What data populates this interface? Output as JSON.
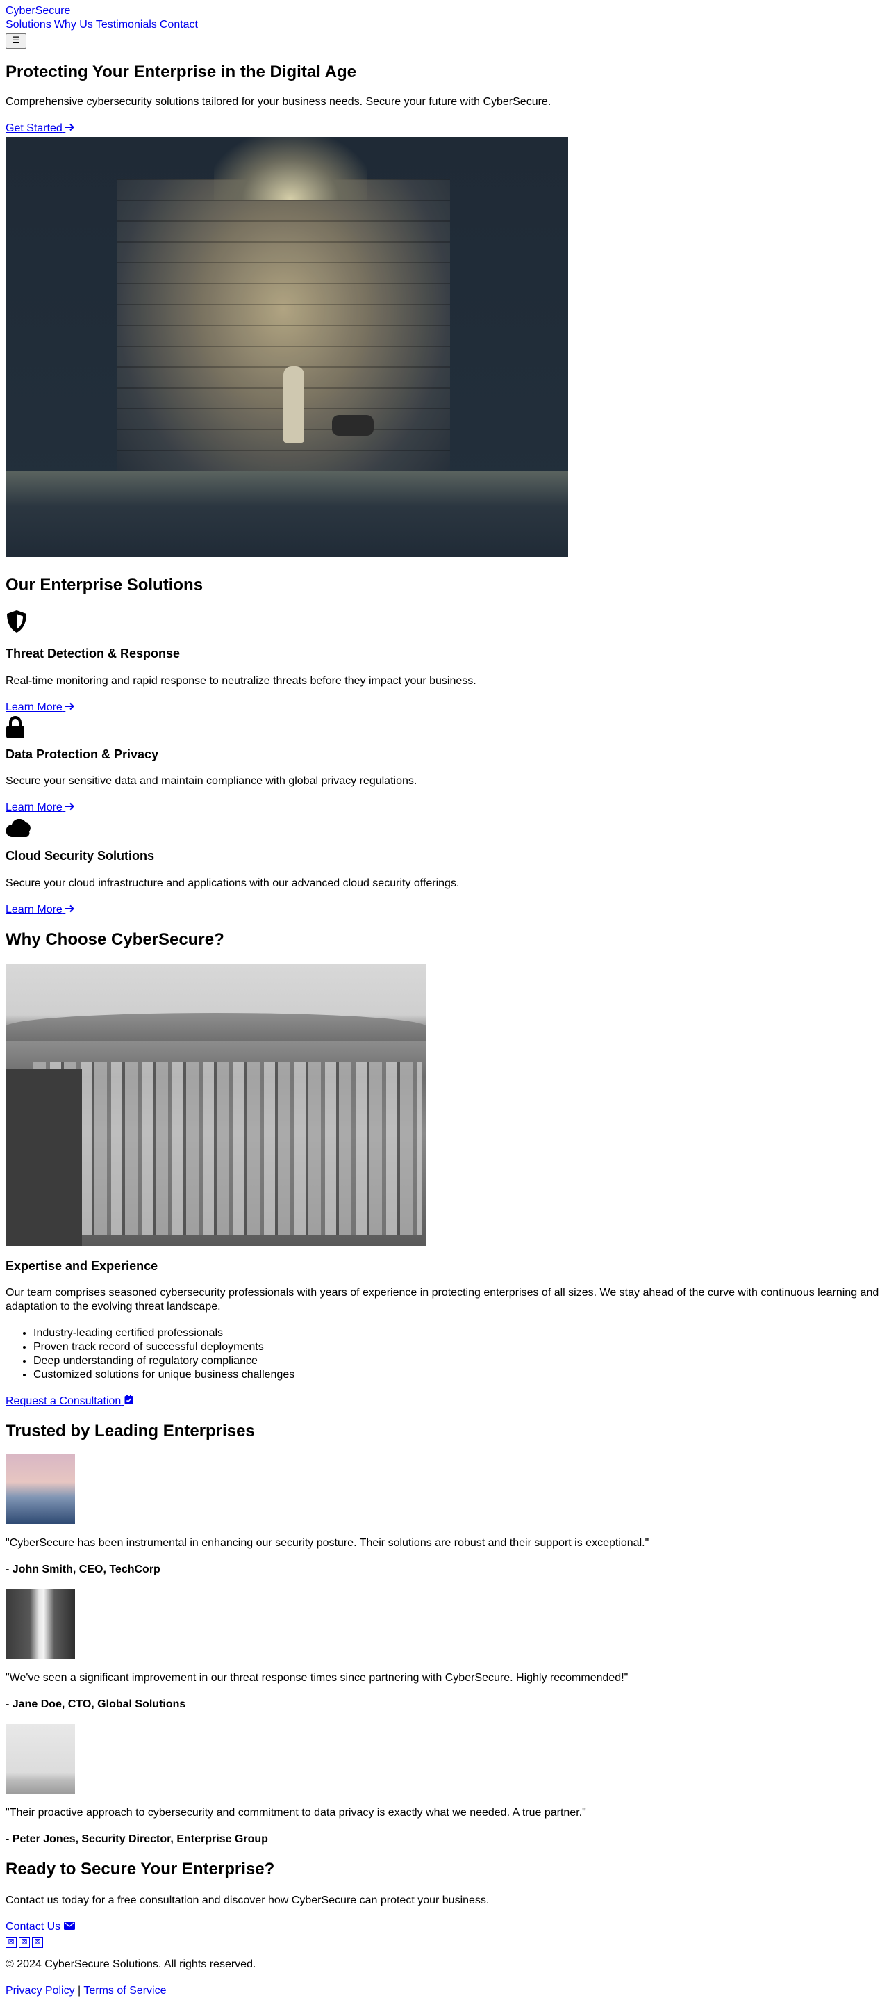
{
  "nav": {
    "brand": "CyberSecure",
    "links": [
      "Solutions",
      "Why Us",
      "Testimonials",
      "Contact"
    ],
    "menu_icon": "☰"
  },
  "hero": {
    "title": "Protecting Your Enterprise in the Digital Age",
    "subtitle": "Comprehensive cybersecurity solutions tailored for your business needs. Secure your future with CyberSecure.",
    "cta_label": "Get Started",
    "cta_icon": "arrow-right-icon"
  },
  "solutions": {
    "heading": "Our Enterprise Solutions",
    "items": [
      {
        "icon": "shield-icon",
        "title": "Threat Detection & Response",
        "description": "Real-time monitoring and rapid response to neutralize threats before they impact your business.",
        "link_label": "Learn More"
      },
      {
        "icon": "lock-icon",
        "title": "Data Protection & Privacy",
        "description": "Secure your sensitive data and maintain compliance with global privacy regulations.",
        "link_label": "Learn More"
      },
      {
        "icon": "cloud-icon",
        "title": "Cloud Security Solutions",
        "description": "Secure your cloud infrastructure and applications with our advanced cloud security offerings.",
        "link_label": "Learn More"
      }
    ]
  },
  "why": {
    "heading": "Why Choose CyberSecure?",
    "subheading": "Expertise and Experience",
    "body": "Our team comprises seasoned cybersecurity professionals with years of experience in protecting enterprises of all sizes. We stay ahead of the curve with continuous learning and adaptation to the evolving threat landscape.",
    "bullets": [
      "Industry-leading certified professionals",
      "Proven track record of successful deployments",
      "Deep understanding of regulatory compliance",
      "Customized solutions for unique business challenges"
    ],
    "cta_label": "Request a Consultation",
    "cta_icon": "calendar-check-icon"
  },
  "testimonials": {
    "heading": "Trusted by Leading Enterprises",
    "items": [
      {
        "quote": "\"CyberSecure has been instrumental in enhancing our security posture. Their solutions are robust and their support is exceptional.\"",
        "author": "- John Smith, CEO, TechCorp"
      },
      {
        "quote": "\"We've seen a significant improvement in our threat response times since partnering with CyberSecure. Highly recommended!\"",
        "author": "- Jane Doe, CTO, Global Solutions"
      },
      {
        "quote": "\"Their proactive approach to cybersecurity and commitment to data privacy is exactly what we needed. A true partner.\"",
        "author": "- Peter Jones, Security Director, Enterprise Group"
      }
    ]
  },
  "contact": {
    "heading": "Ready to Secure Your Enterprise?",
    "body": "Contact us today for a free consultation and discover how CyberSecure can protect your business.",
    "cta_label": "Contact Us",
    "cta_icon": "envelope-icon"
  },
  "footer": {
    "social_icons": [
      "social-icon-1",
      "social-icon-2",
      "social-icon-3"
    ],
    "copyright": "© 2024 CyberSecure Solutions. All rights reserved.",
    "privacy_label": "Privacy Policy",
    "separator": "|",
    "terms_label": "Terms of Service"
  }
}
